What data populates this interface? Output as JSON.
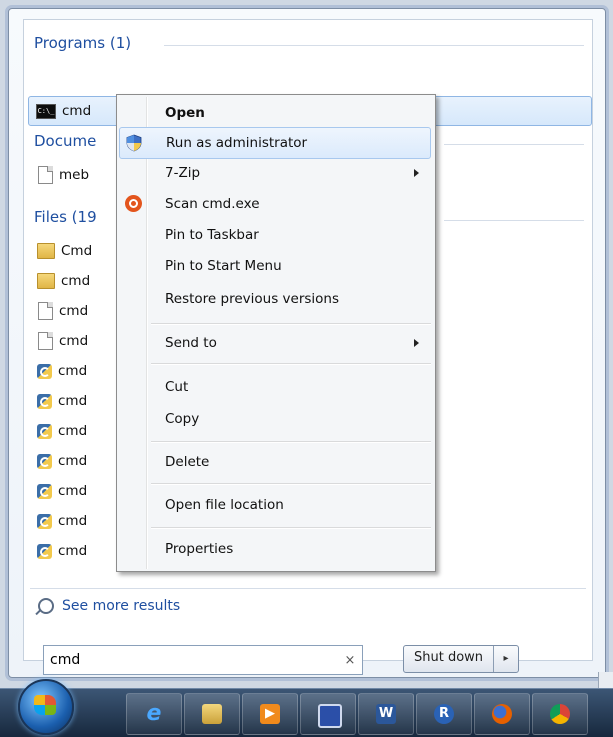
{
  "start_menu": {
    "sections": [
      {
        "header": "Programs (1)",
        "items": [
          {
            "label": "cmd",
            "icon": "cmd-icon"
          }
        ]
      },
      {
        "header": "Docume",
        "items": [
          {
            "label": "meb",
            "icon": "document-icon"
          }
        ]
      },
      {
        "header": "Files (19",
        "items": [
          {
            "label": "Cmd",
            "icon": "folder-icon"
          },
          {
            "label": "cmd",
            "icon": "folder-icon"
          },
          {
            "label": "cmd",
            "icon": "document-icon"
          },
          {
            "label": "cmd",
            "icon": "document-icon"
          },
          {
            "label": "cmd",
            "icon": "python-file-icon"
          },
          {
            "label": "cmd",
            "icon": "python-file-icon"
          },
          {
            "label": "cmd",
            "icon": "python-file-icon"
          },
          {
            "label": "cmd",
            "icon": "python-file-icon"
          },
          {
            "label": "cmd",
            "icon": "python-file-icon"
          },
          {
            "label": "cmd",
            "icon": "python-file-icon"
          },
          {
            "label": "cmd",
            "icon": "python-file-icon"
          }
        ]
      }
    ],
    "see_more": "See more results",
    "search": {
      "value": "cmd",
      "clear": "×"
    },
    "shutdown": {
      "label": "Shut down",
      "arrow": "▸"
    }
  },
  "context_menu": {
    "items": [
      {
        "label": "Open",
        "bold": true
      },
      {
        "label": "Run as administrator",
        "icon": "uac-shield-icon",
        "highlighted": true
      },
      {
        "label": "7-Zip",
        "submenu": true
      },
      {
        "label": "Scan cmd.exe",
        "icon": "scan-icon"
      },
      {
        "label": "Pin to Taskbar"
      },
      {
        "label": "Pin to Start Menu"
      },
      {
        "label": "Restore previous versions"
      },
      {
        "separator": true
      },
      {
        "label": "Send to",
        "submenu": true
      },
      {
        "separator": true
      },
      {
        "label": "Cut"
      },
      {
        "label": "Copy"
      },
      {
        "separator": true
      },
      {
        "label": "Delete"
      },
      {
        "separator": true
      },
      {
        "label": "Open file location"
      },
      {
        "separator": true
      },
      {
        "label": "Properties"
      }
    ]
  },
  "taskbar": {
    "buttons": [
      {
        "name": "internet-explorer-icon",
        "glyph": "e",
        "color": "#1e8fe0"
      },
      {
        "name": "file-explorer-icon",
        "glyph": "",
        "color": "#e8c35a"
      },
      {
        "name": "media-player-icon",
        "glyph": "▶",
        "color": "#f08a1c"
      },
      {
        "name": "save-disk-icon",
        "glyph": "",
        "color": "#2b4fa8"
      },
      {
        "name": "word-icon",
        "glyph": "W",
        "color": "#2b579a"
      },
      {
        "name": "r-app-icon",
        "glyph": "R",
        "color": "#2a62b5"
      },
      {
        "name": "firefox-icon",
        "glyph": "",
        "color": "#e66000"
      },
      {
        "name": "chrome-icon",
        "glyph": "",
        "color": "#db4437"
      }
    ]
  }
}
